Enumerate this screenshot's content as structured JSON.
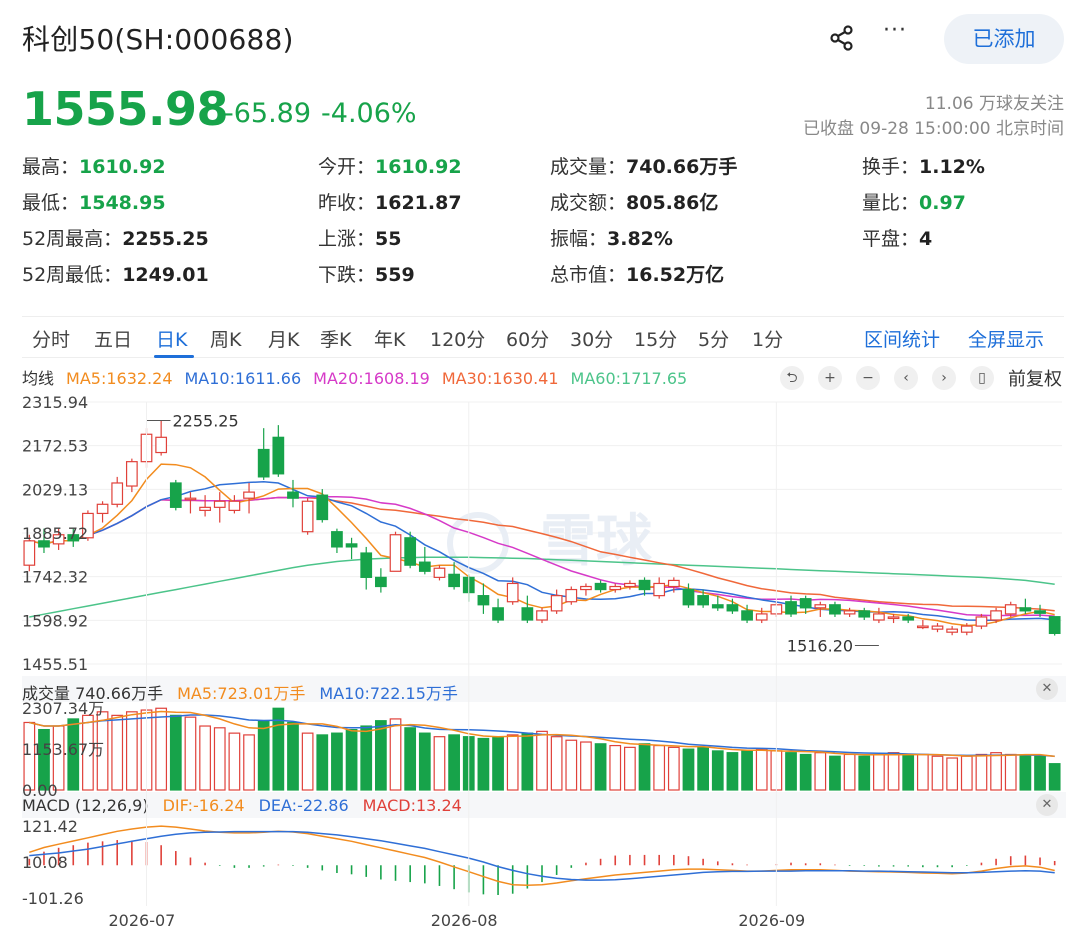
{
  "header": {
    "title": "科创50(SH:000688)",
    "share_icon": "share-icon",
    "more_icon": "more-icon",
    "more_label": "···",
    "added_label": "已添加"
  },
  "quote": {
    "price": "1555.98",
    "change": "-65.89",
    "change_pct": "-4.06%",
    "followers": "11.06 万球友关注",
    "status": "已收盘 09-28 15:00:00 北京时间"
  },
  "stats": [
    {
      "label": "最高：",
      "value": "1610.92",
      "green": true
    },
    {
      "label": "今开：",
      "value": "1610.92",
      "green": true
    },
    {
      "label": "成交量：",
      "value": "740.66万手",
      "green": false
    },
    {
      "label": "换手：",
      "value": "1.12%",
      "green": false
    },
    {
      "label": "最低：",
      "value": "1548.95",
      "green": true
    },
    {
      "label": "昨收：",
      "value": "1621.87",
      "green": false
    },
    {
      "label": "成交额：",
      "value": "805.86亿",
      "green": false
    },
    {
      "label": "量比：",
      "value": "0.97",
      "green": true
    },
    {
      "label": "52周最高：",
      "value": "2255.25",
      "green": false
    },
    {
      "label": "上涨：",
      "value": "55",
      "green": false
    },
    {
      "label": "振幅：",
      "value": "3.82%",
      "green": false
    },
    {
      "label": "平盘：",
      "value": "4",
      "green": false
    },
    {
      "label": "52周最低：",
      "value": "1249.01",
      "green": false
    },
    {
      "label": "下跌：",
      "value": "559",
      "green": false
    },
    {
      "label": "总市值：",
      "value": "16.52万亿",
      "green": false
    }
  ],
  "tabs": [
    "分时",
    "五日",
    "日K",
    "周K",
    "月K",
    "季K",
    "年K",
    "120分",
    "60分",
    "30分",
    "15分",
    "5分",
    "1分"
  ],
  "active_tab": "日K",
  "tab_right": [
    "区间统计",
    "全屏显示"
  ],
  "controls": {
    "icons": [
      "undo-icon",
      "zoom-in-icon",
      "zoom-out-icon",
      "prev-icon",
      "next-icon",
      "candle-style-icon"
    ],
    "glyphs": [
      "⮌",
      "+",
      "−",
      "‹",
      "›",
      "▯"
    ],
    "adjust_label": "前复权"
  },
  "colors": {
    "up": "#e0413a",
    "down": "#17a34a",
    "ma5": "#f28c1f",
    "ma10": "#2f6fd6",
    "ma20": "#d63ac8",
    "ma30": "#f0683a",
    "ma60": "#4cc48a",
    "dif": "#f28c1f",
    "dea": "#2f6fd6"
  },
  "chart_data": [
    {
      "type": "candlestick",
      "legend_title": "均线",
      "ma_legend": [
        "MA5:1632.24",
        "MA10:1611.66",
        "MA20:1608.19",
        "MA30:1630.41",
        "MA60:1717.65"
      ],
      "y_ticks": [
        "2315.94",
        "2172.53",
        "2029.13",
        "1885.72",
        "1742.32",
        "1598.92",
        "1455.51"
      ],
      "ylim": [
        1455.51,
        2315.94
      ],
      "x_ticks": [
        {
          "label": "2026-07",
          "index": 8
        },
        {
          "label": "2026-08",
          "index": 30
        },
        {
          "label": "2026-09",
          "index": 51
        }
      ],
      "annotations": [
        {
          "label": "2255.25",
          "index": 8,
          "value": 2255.25
        },
        {
          "label": "1516.20",
          "index": 58,
          "value": 1516.2
        }
      ],
      "watermark": "雪球",
      "ohlc": [
        [
          1780,
          1880,
          1760,
          1860
        ],
        [
          1860,
          1900,
          1820,
          1840
        ],
        [
          1850,
          1900,
          1830,
          1880
        ],
        [
          1880,
          1900,
          1840,
          1860
        ],
        [
          1870,
          1960,
          1860,
          1950
        ],
        [
          1950,
          1990,
          1920,
          1980
        ],
        [
          1980,
          2070,
          1970,
          2050
        ],
        [
          2040,
          2130,
          2020,
          2120
        ],
        [
          2120,
          2230,
          2100,
          2210
        ],
        [
          2150,
          2255.25,
          2140,
          2200
        ],
        [
          2050,
          2060,
          1960,
          1970
        ],
        [
          2000,
          2020,
          1950,
          2000
        ],
        [
          1960,
          2010,
          1940,
          1970
        ],
        [
          1970,
          2020,
          1920,
          1990
        ],
        [
          1960,
          2010,
          1950,
          1990
        ],
        [
          2000,
          2050,
          1950,
          2020
        ],
        [
          2160,
          2230,
          2060,
          2070
        ],
        [
          2200,
          2240,
          2070,
          2080
        ],
        [
          2020,
          2060,
          1970,
          2000
        ],
        [
          1890,
          2000,
          1880,
          1990
        ],
        [
          2010,
          2030,
          1920,
          1930
        ],
        [
          1890,
          1900,
          1820,
          1840
        ],
        [
          1850,
          1870,
          1800,
          1840
        ],
        [
          1820,
          1840,
          1700,
          1740
        ],
        [
          1740,
          1770,
          1690,
          1710
        ],
        [
          1760,
          1890,
          1760,
          1880
        ],
        [
          1870,
          1890,
          1770,
          1780
        ],
        [
          1790,
          1840,
          1750,
          1760
        ],
        [
          1740,
          1780,
          1730,
          1770
        ],
        [
          1750,
          1790,
          1700,
          1710
        ],
        [
          1740,
          1750,
          1660,
          1690
        ],
        [
          1680,
          1720,
          1620,
          1650
        ],
        [
          1640,
          1670,
          1590,
          1600
        ],
        [
          1660,
          1740,
          1650,
          1720
        ],
        [
          1640,
          1680,
          1590,
          1600
        ],
        [
          1600,
          1640,
          1590,
          1630
        ],
        [
          1630,
          1700,
          1620,
          1680
        ],
        [
          1660,
          1710,
          1650,
          1700
        ],
        [
          1700,
          1720,
          1680,
          1710
        ],
        [
          1720,
          1730,
          1690,
          1700
        ],
        [
          1700,
          1720,
          1690,
          1710
        ],
        [
          1710,
          1730,
          1700,
          1720
        ],
        [
          1730,
          1740,
          1680,
          1700
        ],
        [
          1680,
          1740,
          1670,
          1720
        ],
        [
          1710,
          1740,
          1690,
          1730
        ],
        [
          1700,
          1720,
          1640,
          1650
        ],
        [
          1680,
          1700,
          1640,
          1650
        ],
        [
          1650,
          1680,
          1630,
          1640
        ],
        [
          1650,
          1670,
          1620,
          1630
        ],
        [
          1630,
          1650,
          1590,
          1600
        ],
        [
          1600,
          1640,
          1590,
          1620
        ],
        [
          1620,
          1660,
          1610,
          1650
        ],
        [
          1660,
          1680,
          1610,
          1620
        ],
        [
          1670,
          1680,
          1620,
          1640
        ],
        [
          1640,
          1660,
          1610,
          1650
        ],
        [
          1650,
          1660,
          1610,
          1620
        ],
        [
          1620,
          1640,
          1610,
          1630
        ],
        [
          1630,
          1640,
          1600,
          1610
        ],
        [
          1600,
          1640,
          1590,
          1620
        ],
        [
          1610,
          1620,
          1590,
          1610
        ],
        [
          1610,
          1620,
          1590,
          1600
        ],
        [
          1580,
          1600,
          1570,
          1580
        ],
        [
          1570,
          1590,
          1560,
          1580
        ],
        [
          1560,
          1580,
          1550,
          1570
        ],
        [
          1560,
          1590,
          1550,
          1580
        ],
        [
          1580,
          1620,
          1570,
          1610
        ],
        [
          1600,
          1640,
          1590,
          1630
        ],
        [
          1620,
          1660,
          1610,
          1650
        ],
        [
          1640,
          1670,
          1620,
          1630
        ],
        [
          1630,
          1650,
          1610,
          1622
        ],
        [
          1610.92,
          1610.92,
          1548.95,
          1555.98
        ]
      ],
      "ma60_values": [
        1610,
        1619,
        1628,
        1637,
        1646,
        1655,
        1664,
        1673,
        1682,
        1691,
        1700,
        1709,
        1718,
        1727,
        1736,
        1745,
        1754,
        1763,
        1772,
        1780,
        1786,
        1792,
        1796,
        1800,
        1802,
        1804,
        1805,
        1806,
        1806,
        1806,
        1806,
        1805,
        1804,
        1803,
        1802,
        1800,
        1798,
        1796,
        1794,
        1792,
        1790,
        1788,
        1786,
        1784,
        1782,
        1780,
        1778,
        1776,
        1774,
        1772,
        1770,
        1768,
        1766,
        1764,
        1762,
        1760,
        1758,
        1756,
        1754,
        1752,
        1750,
        1748,
        1746,
        1744,
        1742,
        1740,
        1737,
        1734,
        1730,
        1724,
        1717.65
      ]
    },
    {
      "type": "bar",
      "legend_title": "成交量 740.66万手",
      "ma_legend": [
        "MA5:723.01万手",
        "MA10:722.15万手"
      ],
      "y_ticks": [
        "2307.34万",
        "1153.67万",
        "0.00"
      ],
      "ylim": [
        0,
        2307.34
      ],
      "unit": "万手",
      "values": [
        1900,
        1700,
        1800,
        2000,
        2100,
        2200,
        2100,
        2200,
        2250,
        2300,
        2100,
        2050,
        1800,
        1750,
        1600,
        1550,
        1950,
        2300,
        1900,
        1600,
        1550,
        1600,
        1700,
        1800,
        1950,
        2000,
        1750,
        1600,
        1500,
        1550,
        1500,
        1450,
        1500,
        1550,
        1600,
        1650,
        1500,
        1400,
        1350,
        1300,
        1250,
        1200,
        1300,
        1250,
        1200,
        1150,
        1200,
        1100,
        1050,
        1100,
        1150,
        1100,
        1050,
        1000,
        1050,
        950,
        1000,
        950,
        1000,
        1050,
        980,
        1000,
        950,
        900,
        950,
        1000,
        1050,
        1000,
        980,
        950,
        740.66
      ]
    },
    {
      "type": "macd",
      "legend_title": "MACD (12,26,9)",
      "legend": [
        "DIF:-16.24",
        "DEA:-22.86",
        "MACD:13.24"
      ],
      "y_ticks": [
        "121.42",
        "10.08",
        "-101.26"
      ],
      "ylim": [
        -101.26,
        121.42
      ],
      "dif": [
        40,
        55,
        65,
        75,
        85,
        95,
        105,
        112,
        118,
        121,
        118,
        112,
        106,
        102,
        100,
        100,
        102,
        105,
        103,
        98,
        90,
        82,
        74,
        64,
        54,
        44,
        34,
        24,
        10,
        -5,
        -20,
        -35,
        -50,
        -60,
        -62,
        -60,
        -55,
        -48,
        -42,
        -36,
        -30,
        -26,
        -22,
        -18,
        -14,
        -12,
        -12,
        -14,
        -16,
        -18,
        -18,
        -16,
        -14,
        -14,
        -14,
        -16,
        -18,
        -19,
        -20,
        -21,
        -22,
        -24,
        -25,
        -26,
        -24,
        -18,
        -10,
        -4,
        -2,
        -6,
        -16.24
      ],
      "dea": [
        30,
        34,
        38,
        44,
        50,
        58,
        66,
        74,
        82,
        90,
        96,
        100,
        102,
        103,
        104,
        104,
        104,
        104,
        104,
        102,
        98,
        94,
        88,
        82,
        76,
        68,
        60,
        52,
        42,
        32,
        22,
        10,
        -4,
        -16,
        -26,
        -34,
        -40,
        -44,
        -46,
        -46,
        -45,
        -42,
        -38,
        -34,
        -30,
        -26,
        -22,
        -20,
        -19,
        -19,
        -18,
        -18,
        -18,
        -17,
        -17,
        -17,
        -17,
        -18,
        -18,
        -19,
        -20,
        -21,
        -22,
        -23,
        -23,
        -22,
        -20,
        -18,
        -17,
        -18,
        -22.86
      ],
      "macd": [
        20,
        42,
        54,
        62,
        70,
        74,
        78,
        76,
        72,
        62,
        44,
        24,
        8,
        -2,
        -8,
        -8,
        -4,
        2,
        -2,
        -8,
        -16,
        -24,
        -28,
        -36,
        -44,
        -48,
        -52,
        -56,
        -64,
        -74,
        -84,
        -90,
        -92,
        -88,
        -72,
        -52,
        -30,
        -8,
        8,
        20,
        30,
        32,
        32,
        32,
        32,
        28,
        20,
        12,
        6,
        2,
        0,
        4,
        8,
        6,
        6,
        2,
        -2,
        -2,
        -4,
        -4,
        -4,
        -6,
        -6,
        -6,
        -2,
        8,
        20,
        28,
        30,
        24,
        13.24
      ]
    }
  ]
}
